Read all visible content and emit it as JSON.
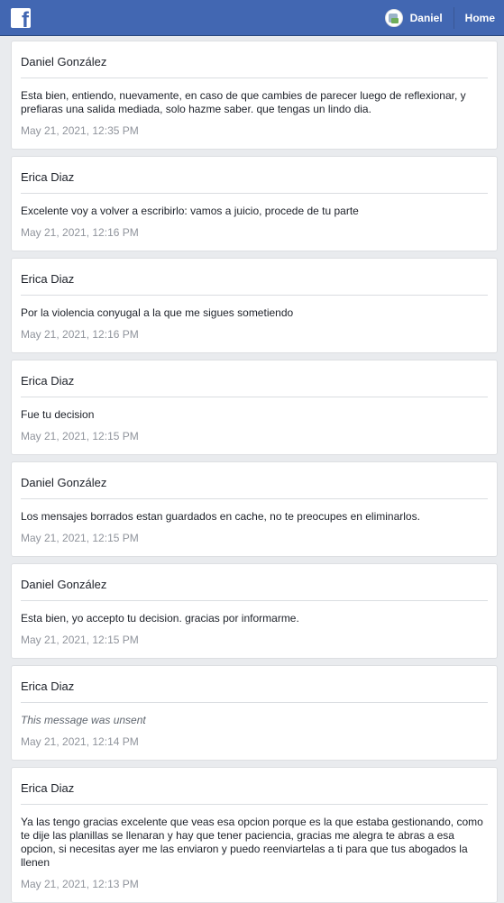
{
  "header": {
    "logo_icon": "facebook-f-icon",
    "profile_name": "Daniel",
    "home_label": "Home",
    "colors": {
      "bar": "#4267b2",
      "background": "#e9ebee"
    }
  },
  "messages": [
    {
      "sender": "Daniel González",
      "text": "Esta bien, entiendo, nuevamente, en caso de que cambies de parecer luego de reflexionar, y prefiaras una salida mediada, solo hazme saber. que tengas un lindo dia.",
      "time": "May 21, 2021, 12:35 PM"
    },
    {
      "sender": "Erica Diaz",
      "text": "Excelente voy a volver a escribirlo: vamos a juicio, procede de tu parte",
      "time": "May 21, 2021, 12:16 PM"
    },
    {
      "sender": "Erica Diaz",
      "text": "Por la violencia conyugal a la que me sigues sometiendo",
      "time": "May 21, 2021, 12:16 PM"
    },
    {
      "sender": "Erica Diaz",
      "text": "Fue tu decision",
      "time": "May 21, 2021, 12:15 PM"
    },
    {
      "sender": "Daniel González",
      "text": "Los mensajes borrados estan guardados en cache, no te preocupes en eliminarlos.",
      "time": "May 21, 2021, 12:15 PM"
    },
    {
      "sender": "Daniel González",
      "text": "Esta bien, yo accepto tu decision. gracias por informarme.",
      "time": "May 21, 2021, 12:15 PM"
    },
    {
      "sender": "Erica Diaz",
      "text": "This message was unsent",
      "time": "May 21, 2021, 12:14 PM"
    },
    {
      "sender": "Erica Diaz",
      "text": "Ya las tengo gracias excelente que veas esa opcion porque es la que estaba gestionando, como te dije las planillas se llenaran y hay que tener paciencia, gracias me alegra te abras a esa opcion, si necesitas ayer me las enviaron y puedo reenviartelas a ti para que tus abogados la llenen",
      "time": "May 21, 2021, 12:13 PM"
    }
  ]
}
